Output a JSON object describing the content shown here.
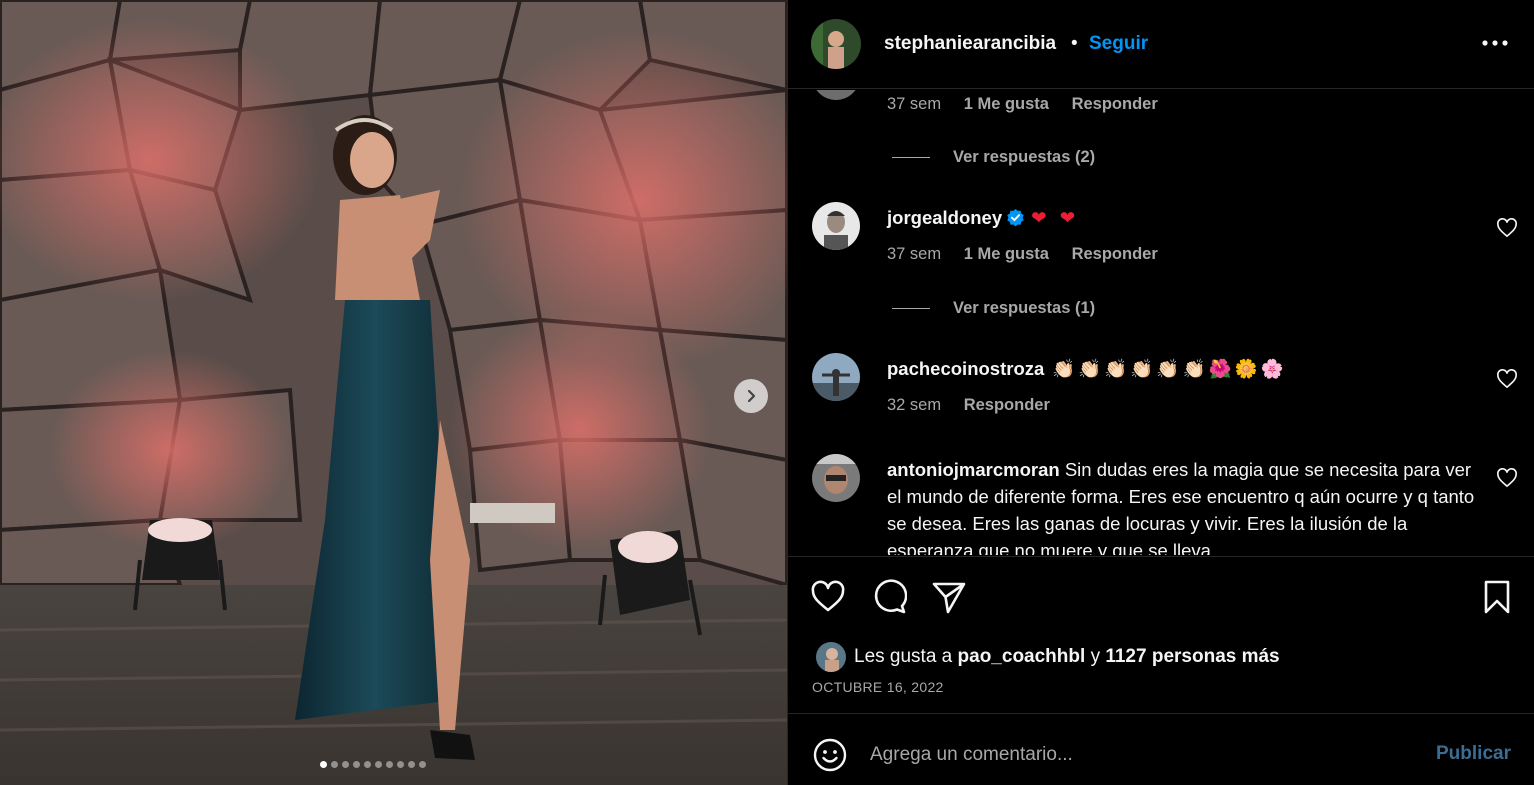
{
  "post": {
    "author": "stephaniearancibia",
    "separator": "•",
    "follow_label": "Seguir",
    "more_icon": "more-horizontal-icon",
    "carousel_slide_count": 10,
    "carousel_active_index": 0
  },
  "comments": [
    {
      "partial": true,
      "time": "37 sem",
      "likes": "1 Me gusta",
      "reply": "Responder",
      "view_replies": "Ver respuestas (2)"
    },
    {
      "username": "jorgealdoney",
      "verified": true,
      "text": "❤ ❤",
      "time": "37 sem",
      "likes": "1 Me gusta",
      "reply": "Responder",
      "view_replies": "Ver respuestas (1)"
    },
    {
      "username": "pachecoinostroza",
      "text": "👏🏻👏🏻👏🏻👏🏻👏🏻👏🏻🌺🌼🌸",
      "time": "32 sem",
      "reply": "Responder"
    },
    {
      "username": "antoniojmarcmoran",
      "text": "Sin dudas eres la magia que se necesita para ver el mundo de diferente forma. Eres ese encuentro q aún ocurre y q tanto se desea. Eres las ganas de locuras y vivir. Eres la ilusión de la esperanza que no muere y que se lleva"
    }
  ],
  "actions": {
    "like_icon": "heart-icon",
    "comment_icon": "comment-bubble-icon",
    "share_icon": "paper-plane-icon",
    "save_icon": "bookmark-icon"
  },
  "likes": {
    "prefix": "Les gusta a",
    "user": "pao_coachhbl",
    "joiner": "y",
    "others": "1127 personas más"
  },
  "date": "OCTUBRE 16, 2022",
  "composer": {
    "placeholder": "Agrega un comentario...",
    "publish_label": "Publicar"
  },
  "colors": {
    "background": "#000000",
    "follow_blue": "#0095f6",
    "muted_text": "#a8a8a8",
    "divider": "#262626",
    "publish_disabled": "#3b6d94"
  }
}
